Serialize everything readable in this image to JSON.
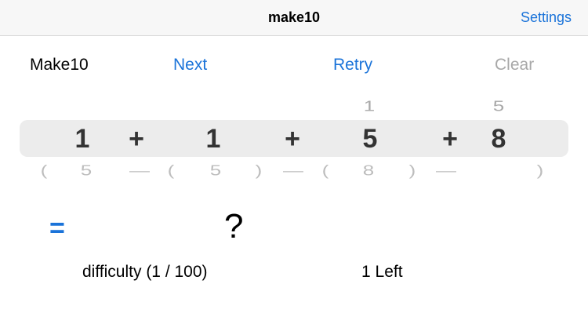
{
  "navbar": {
    "title": "make10",
    "settings_label": "Settings"
  },
  "toolbar": {
    "app_label": "Make10",
    "next_label": "Next",
    "retry_label": "Retry",
    "clear_label": "Clear"
  },
  "picker": {
    "above": [
      "",
      "",
      "",
      "",
      "",
      "",
      "1",
      "",
      "5"
    ],
    "selected": [
      "1",
      "+",
      "1",
      "+",
      "5",
      "+",
      "8"
    ],
    "below": [
      "(",
      "5",
      "—",
      "(",
      "5",
      ")",
      "—",
      "(",
      "8",
      ")",
      "—",
      ")"
    ]
  },
  "result": {
    "equals": "=",
    "value": "?"
  },
  "status": {
    "difficulty": "difficulty (1 / 100)",
    "remaining": "1 Left"
  },
  "colors": {
    "accent": "#1a73d9",
    "disabled": "#a8a8a8",
    "picker_band": "#ececec"
  }
}
